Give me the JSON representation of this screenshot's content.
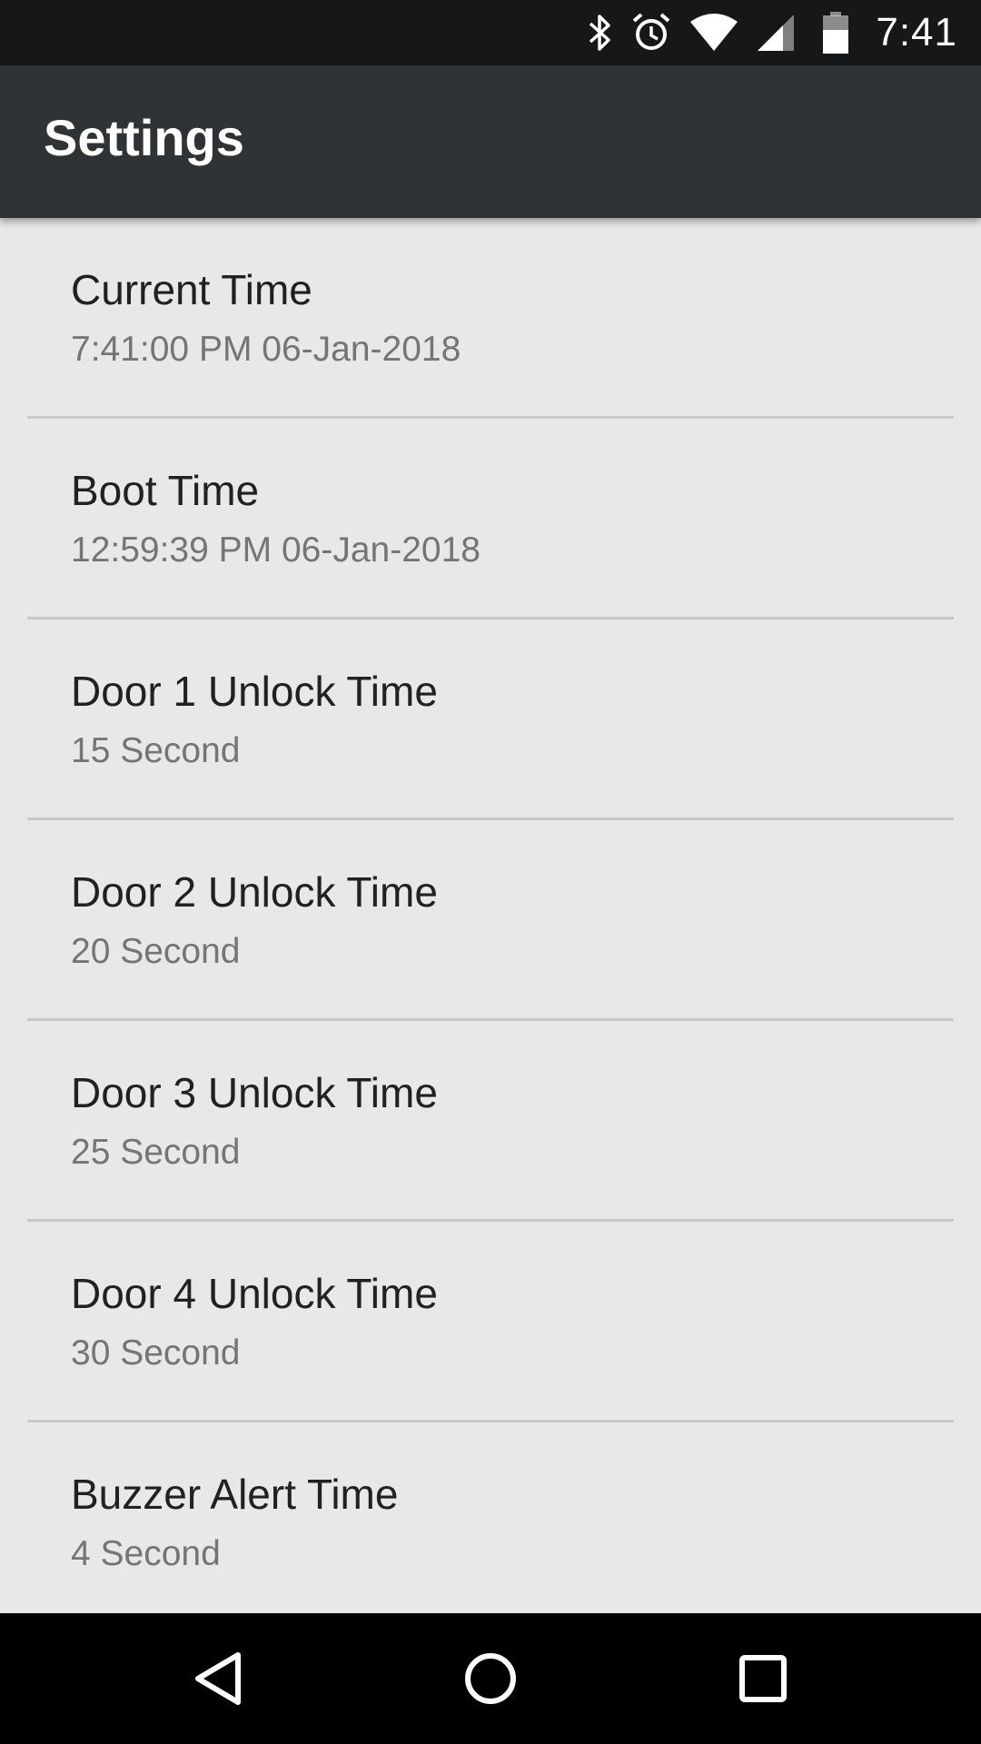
{
  "status_bar": {
    "time": "7:41",
    "icons": [
      "bluetooth-icon",
      "alarm-icon",
      "wifi-icon",
      "cell-signal-icon",
      "battery-icon"
    ]
  },
  "app_bar": {
    "title": "Settings"
  },
  "preferences": [
    {
      "title": "Current Time",
      "summary": "7:41:00 PM 06-Jan-2018"
    },
    {
      "title": "Boot Time",
      "summary": "12:59:39 PM 06-Jan-2018"
    },
    {
      "title": "Door 1 Unlock Time",
      "summary": "15 Second"
    },
    {
      "title": "Door 2 Unlock Time",
      "summary": "20 Second"
    },
    {
      "title": "Door 3 Unlock Time",
      "summary": "25 Second"
    },
    {
      "title": "Door 4 Unlock Time",
      "summary": "30 Second"
    },
    {
      "title": "Buzzer Alert Time",
      "summary": "4 Second"
    }
  ],
  "nav_bar": {
    "icons": [
      "back-icon",
      "home-icon",
      "recents-icon"
    ]
  },
  "colors": {
    "status_bar": "#151718",
    "app_bar": "#303336",
    "background": "#e8e8e8",
    "title_text": "#212121",
    "summary_text": "#757575",
    "divider": "#c8c8c8",
    "nav_bar": "#000000"
  }
}
